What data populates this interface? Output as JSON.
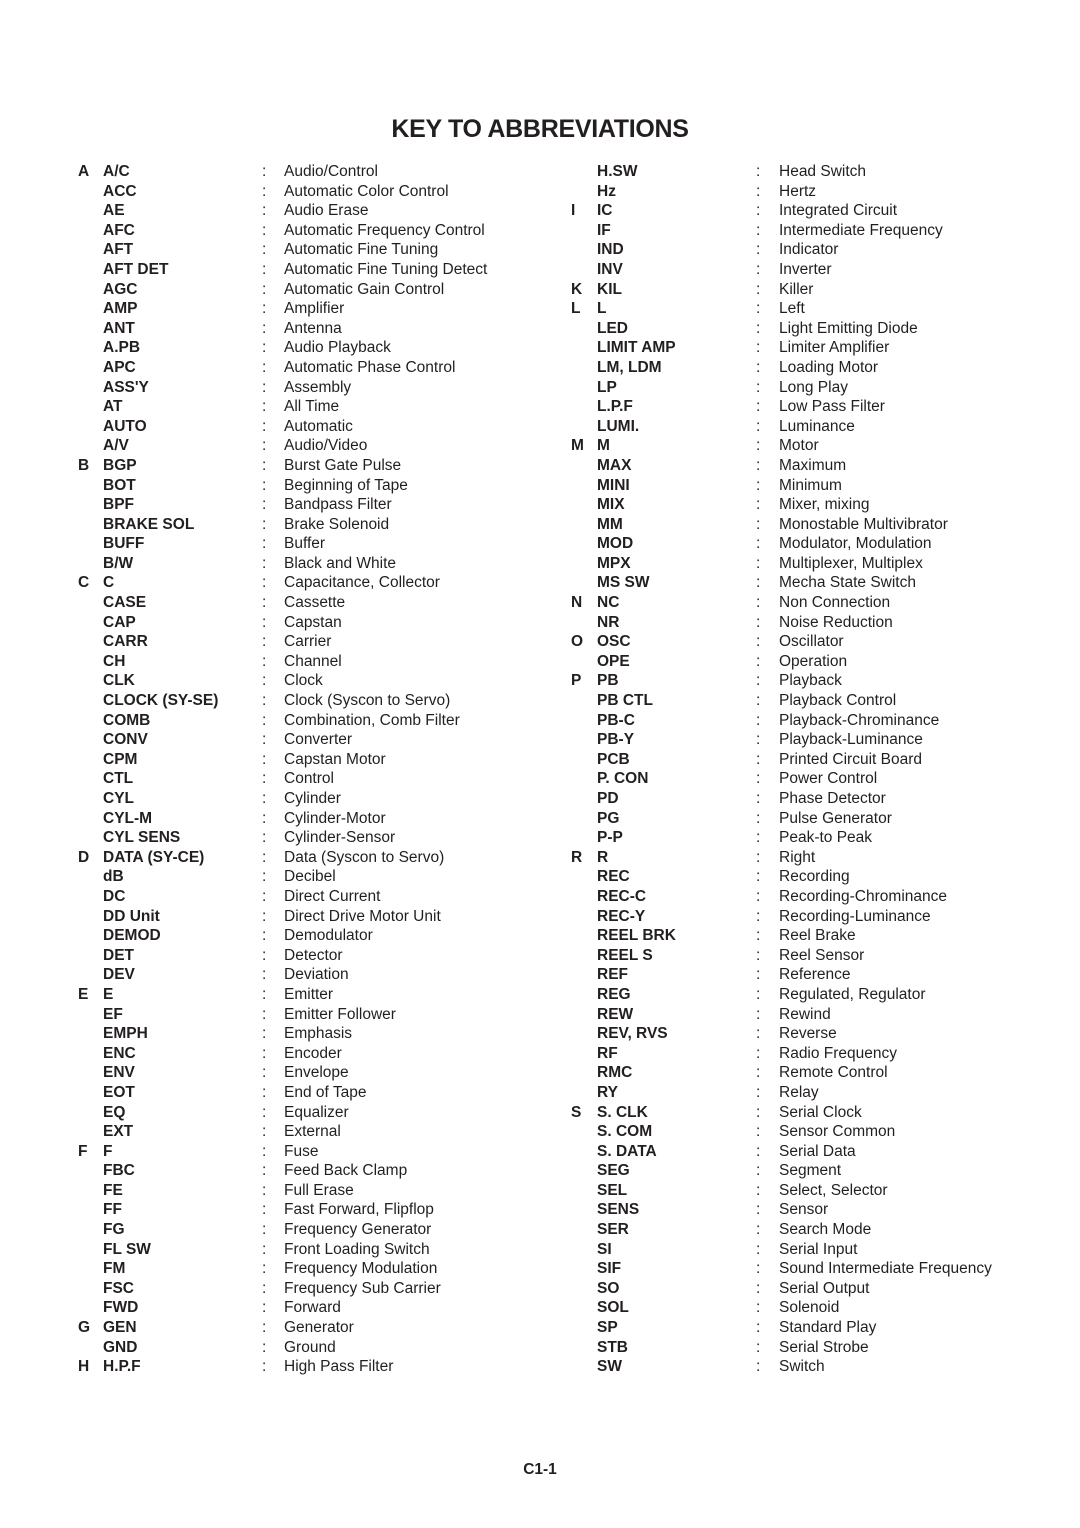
{
  "title": "KEY TO ABBREVIATIONS",
  "page_number": "C1-1",
  "columns": [
    [
      {
        "letter": "A",
        "abbr": "A/C",
        "meaning": "Audio/Control"
      },
      {
        "letter": "",
        "abbr": "ACC",
        "meaning": "Automatic Color Control"
      },
      {
        "letter": "",
        "abbr": "AE",
        "meaning": "Audio Erase"
      },
      {
        "letter": "",
        "abbr": "AFC",
        "meaning": "Automatic Frequency Control"
      },
      {
        "letter": "",
        "abbr": "AFT",
        "meaning": "Automatic Fine Tuning"
      },
      {
        "letter": "",
        "abbr": "AFT DET",
        "meaning": "Automatic Fine Tuning Detect"
      },
      {
        "letter": "",
        "abbr": "AGC",
        "meaning": "Automatic Gain Control"
      },
      {
        "letter": "",
        "abbr": "AMP",
        "meaning": "Amplifier"
      },
      {
        "letter": "",
        "abbr": "ANT",
        "meaning": "Antenna"
      },
      {
        "letter": "",
        "abbr": "A.PB",
        "meaning": "Audio Playback"
      },
      {
        "letter": "",
        "abbr": "APC",
        "meaning": "Automatic Phase Control"
      },
      {
        "letter": "",
        "abbr": "ASS'Y",
        "meaning": "Assembly"
      },
      {
        "letter": "",
        "abbr": "AT",
        "meaning": "All Time"
      },
      {
        "letter": "",
        "abbr": "AUTO",
        "meaning": "Automatic"
      },
      {
        "letter": "",
        "abbr": "A/V",
        "meaning": "Audio/Video"
      },
      {
        "letter": "B",
        "abbr": "BGP",
        "meaning": "Burst Gate Pulse"
      },
      {
        "letter": "",
        "abbr": "BOT",
        "meaning": "Beginning of Tape"
      },
      {
        "letter": "",
        "abbr": "BPF",
        "meaning": "Bandpass Filter"
      },
      {
        "letter": "",
        "abbr": "BRAKE SOL",
        "meaning": "Brake Solenoid"
      },
      {
        "letter": "",
        "abbr": "BUFF",
        "meaning": "Buffer"
      },
      {
        "letter": "",
        "abbr": "B/W",
        "meaning": "Black and White"
      },
      {
        "letter": "C",
        "abbr": "C",
        "meaning": "Capacitance, Collector"
      },
      {
        "letter": "",
        "abbr": "CASE",
        "meaning": "Cassette"
      },
      {
        "letter": "",
        "abbr": "CAP",
        "meaning": "Capstan"
      },
      {
        "letter": "",
        "abbr": "CARR",
        "meaning": "Carrier"
      },
      {
        "letter": "",
        "abbr": "CH",
        "meaning": "Channel"
      },
      {
        "letter": "",
        "abbr": "CLK",
        "meaning": "Clock"
      },
      {
        "letter": "",
        "abbr": "CLOCK (SY-SE)",
        "meaning": "Clock (Syscon to Servo)"
      },
      {
        "letter": "",
        "abbr": "COMB",
        "meaning": "Combination, Comb Filter"
      },
      {
        "letter": "",
        "abbr": "CONV",
        "meaning": "Converter"
      },
      {
        "letter": "",
        "abbr": "CPM",
        "meaning": "Capstan Motor"
      },
      {
        "letter": "",
        "abbr": "CTL",
        "meaning": "Control"
      },
      {
        "letter": "",
        "abbr": "CYL",
        "meaning": "Cylinder"
      },
      {
        "letter": "",
        "abbr": "CYL-M",
        "meaning": "Cylinder-Motor"
      },
      {
        "letter": "",
        "abbr": "CYL SENS",
        "meaning": "Cylinder-Sensor"
      },
      {
        "letter": "D",
        "abbr": "DATA (SY-CE)",
        "meaning": "Data (Syscon to Servo)"
      },
      {
        "letter": "",
        "abbr": "dB",
        "meaning": "Decibel"
      },
      {
        "letter": "",
        "abbr": "DC",
        "meaning": "Direct Current"
      },
      {
        "letter": "",
        "abbr": "DD Unit",
        "meaning": "Direct Drive Motor Unit"
      },
      {
        "letter": "",
        "abbr": "DEMOD",
        "meaning": "Demodulator"
      },
      {
        "letter": "",
        "abbr": "DET",
        "meaning": "Detector"
      },
      {
        "letter": "",
        "abbr": "DEV",
        "meaning": "Deviation"
      },
      {
        "letter": "E",
        "abbr": "E",
        "meaning": "Emitter"
      },
      {
        "letter": "",
        "abbr": "EF",
        "meaning": "Emitter Follower"
      },
      {
        "letter": "",
        "abbr": "EMPH",
        "meaning": "Emphasis"
      },
      {
        "letter": "",
        "abbr": "ENC",
        "meaning": "Encoder"
      },
      {
        "letter": "",
        "abbr": "ENV",
        "meaning": "Envelope"
      },
      {
        "letter": "",
        "abbr": "EOT",
        "meaning": "End of Tape"
      },
      {
        "letter": "",
        "abbr": "EQ",
        "meaning": "Equalizer"
      },
      {
        "letter": "",
        "abbr": "EXT",
        "meaning": "External"
      },
      {
        "letter": "F",
        "abbr": "F",
        "meaning": "Fuse"
      },
      {
        "letter": "",
        "abbr": "FBC",
        "meaning": "Feed Back Clamp"
      },
      {
        "letter": "",
        "abbr": "FE",
        "meaning": "Full Erase"
      },
      {
        "letter": "",
        "abbr": "FF",
        "meaning": "Fast Forward, Flipflop"
      },
      {
        "letter": "",
        "abbr": "FG",
        "meaning": "Frequency Generator"
      },
      {
        "letter": "",
        "abbr": "FL SW",
        "meaning": "Front Loading Switch"
      },
      {
        "letter": "",
        "abbr": "FM",
        "meaning": "Frequency Modulation"
      },
      {
        "letter": "",
        "abbr": "FSC",
        "meaning": "Frequency Sub Carrier"
      },
      {
        "letter": "",
        "abbr": "FWD",
        "meaning": "Forward"
      },
      {
        "letter": "G",
        "abbr": "GEN",
        "meaning": "Generator"
      },
      {
        "letter": "",
        "abbr": "GND",
        "meaning": "Ground"
      },
      {
        "letter": "H",
        "abbr": "H.P.F",
        "meaning": "High Pass Filter"
      }
    ],
    [
      {
        "letter": "",
        "abbr": "H.SW",
        "meaning": "Head Switch"
      },
      {
        "letter": "",
        "abbr": "Hz",
        "meaning": "Hertz"
      },
      {
        "letter": "I",
        "abbr": "IC",
        "meaning": "Integrated Circuit"
      },
      {
        "letter": "",
        "abbr": "IF",
        "meaning": "Intermediate Frequency"
      },
      {
        "letter": "",
        "abbr": "IND",
        "meaning": "Indicator"
      },
      {
        "letter": "",
        "abbr": "INV",
        "meaning": "Inverter"
      },
      {
        "letter": "K",
        "abbr": "KIL",
        "meaning": "Killer"
      },
      {
        "letter": "L",
        "abbr": "L",
        "meaning": "Left"
      },
      {
        "letter": "",
        "abbr": "LED",
        "meaning": "Light Emitting Diode"
      },
      {
        "letter": "",
        "abbr": "LIMIT AMP",
        "meaning": "Limiter Amplifier"
      },
      {
        "letter": "",
        "abbr": "LM, LDM",
        "meaning": "Loading Motor"
      },
      {
        "letter": "",
        "abbr": "LP",
        "meaning": "Long Play"
      },
      {
        "letter": "",
        "abbr": "L.P.F",
        "meaning": "Low Pass Filter"
      },
      {
        "letter": "",
        "abbr": "LUMI.",
        "meaning": "Luminance"
      },
      {
        "letter": "M",
        "abbr": "M",
        "meaning": "Motor"
      },
      {
        "letter": "",
        "abbr": "MAX",
        "meaning": "Maximum"
      },
      {
        "letter": "",
        "abbr": "MINI",
        "meaning": "Minimum"
      },
      {
        "letter": "",
        "abbr": "MIX",
        "meaning": "Mixer, mixing"
      },
      {
        "letter": "",
        "abbr": "MM",
        "meaning": "Monostable Multivibrator"
      },
      {
        "letter": "",
        "abbr": "MOD",
        "meaning": "Modulator, Modulation"
      },
      {
        "letter": "",
        "abbr": "MPX",
        "meaning": "Multiplexer, Multiplex"
      },
      {
        "letter": "",
        "abbr": "MS SW",
        "meaning": "Mecha State Switch"
      },
      {
        "letter": "N",
        "abbr": "NC",
        "meaning": "Non Connection"
      },
      {
        "letter": "",
        "abbr": "NR",
        "meaning": "Noise Reduction"
      },
      {
        "letter": "O",
        "abbr": "OSC",
        "meaning": "Oscillator"
      },
      {
        "letter": "",
        "abbr": "OPE",
        "meaning": "Operation"
      },
      {
        "letter": "P",
        "abbr": "PB",
        "meaning": "Playback"
      },
      {
        "letter": "",
        "abbr": "PB CTL",
        "meaning": "Playback Control"
      },
      {
        "letter": "",
        "abbr": "PB-C",
        "meaning": "Playback-Chrominance"
      },
      {
        "letter": "",
        "abbr": "PB-Y",
        "meaning": "Playback-Luminance"
      },
      {
        "letter": "",
        "abbr": "PCB",
        "meaning": "Printed Circuit Board"
      },
      {
        "letter": "",
        "abbr": "P. CON",
        "meaning": "Power Control"
      },
      {
        "letter": "",
        "abbr": "PD",
        "meaning": "Phase Detector"
      },
      {
        "letter": "",
        "abbr": "PG",
        "meaning": "Pulse Generator"
      },
      {
        "letter": "",
        "abbr": "P-P",
        "meaning": "Peak-to Peak"
      },
      {
        "letter": "R",
        "abbr": "R",
        "meaning": "Right"
      },
      {
        "letter": "",
        "abbr": "REC",
        "meaning": "Recording"
      },
      {
        "letter": "",
        "abbr": "REC-C",
        "meaning": "Recording-Chrominance"
      },
      {
        "letter": "",
        "abbr": "REC-Y",
        "meaning": "Recording-Luminance"
      },
      {
        "letter": "",
        "abbr": "REEL BRK",
        "meaning": "Reel Brake"
      },
      {
        "letter": "",
        "abbr": "REEL S",
        "meaning": "Reel Sensor"
      },
      {
        "letter": "",
        "abbr": "REF",
        "meaning": "Reference"
      },
      {
        "letter": "",
        "abbr": "REG",
        "meaning": "Regulated, Regulator"
      },
      {
        "letter": "",
        "abbr": "REW",
        "meaning": "Rewind"
      },
      {
        "letter": "",
        "abbr": "REV, RVS",
        "meaning": "Reverse"
      },
      {
        "letter": "",
        "abbr": "RF",
        "meaning": "Radio Frequency"
      },
      {
        "letter": "",
        "abbr": "RMC",
        "meaning": "Remote Control"
      },
      {
        "letter": "",
        "abbr": "RY",
        "meaning": "Relay"
      },
      {
        "letter": "S",
        "abbr": "S. CLK",
        "meaning": "Serial Clock"
      },
      {
        "letter": "",
        "abbr": "S. COM",
        "meaning": "Sensor Common"
      },
      {
        "letter": "",
        "abbr": "S. DATA",
        "meaning": "Serial Data"
      },
      {
        "letter": "",
        "abbr": "SEG",
        "meaning": "Segment"
      },
      {
        "letter": "",
        "abbr": "SEL",
        "meaning": "Select, Selector"
      },
      {
        "letter": "",
        "abbr": "SENS",
        "meaning": "Sensor"
      },
      {
        "letter": "",
        "abbr": "SER",
        "meaning": "Search Mode"
      },
      {
        "letter": "",
        "abbr": "SI",
        "meaning": "Serial Input"
      },
      {
        "letter": "",
        "abbr": "SIF",
        "meaning": "Sound Intermediate Frequency"
      },
      {
        "letter": "",
        "abbr": "SO",
        "meaning": "Serial Output"
      },
      {
        "letter": "",
        "abbr": "SOL",
        "meaning": "Solenoid"
      },
      {
        "letter": "",
        "abbr": "SP",
        "meaning": "Standard Play"
      },
      {
        "letter": "",
        "abbr": "STB",
        "meaning": "Serial Strobe"
      },
      {
        "letter": "",
        "abbr": "SW",
        "meaning": "Switch"
      }
    ]
  ],
  "separator": ":"
}
